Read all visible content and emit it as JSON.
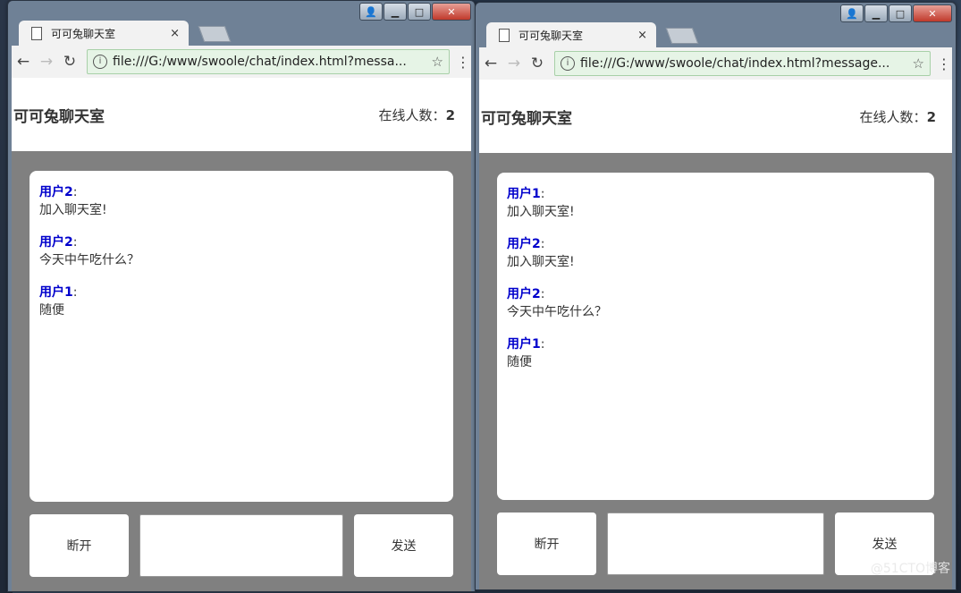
{
  "windows": [
    {
      "tab_title": "可可兔聊天室",
      "url": "file:///G:/www/swoole/chat/index.html?messa...",
      "room_title": "可可兔聊天室",
      "online_label": "在线人数：",
      "online_count": "2",
      "messages": [
        {
          "user": "用户2",
          "sep": ":",
          "text": "加入聊天室!"
        },
        {
          "user": "用户2",
          "sep": ":",
          "text": "今天中午吃什么？"
        },
        {
          "user": "用户1",
          "sep": ":",
          "text": "随便"
        }
      ],
      "disconnect_label": "断开",
      "send_label": "发送"
    },
    {
      "tab_title": "可可兔聊天室",
      "url": "file:///G:/www/swoole/chat/index.html?message...",
      "room_title": "可可兔聊天室",
      "online_label": "在线人数：",
      "online_count": "2",
      "messages": [
        {
          "user": "用户1",
          "sep": ":",
          "text": "加入聊天室!"
        },
        {
          "user": "用户2",
          "sep": ":",
          "text": "加入聊天室!"
        },
        {
          "user": "用户2",
          "sep": ":",
          "text": "今天中午吃什么？"
        },
        {
          "user": "用户1",
          "sep": ":",
          "text": "随便"
        }
      ],
      "disconnect_label": "断开",
      "send_label": "发送"
    }
  ],
  "icons": {
    "back": "←",
    "forward": "→",
    "reload": "↻",
    "info": "i",
    "star": "☆",
    "menu": "⋮",
    "close": "×",
    "minimize": "▁",
    "maximize": "□",
    "user": "👤",
    "win_close": "✕"
  },
  "watermark": "@51CTO博客"
}
